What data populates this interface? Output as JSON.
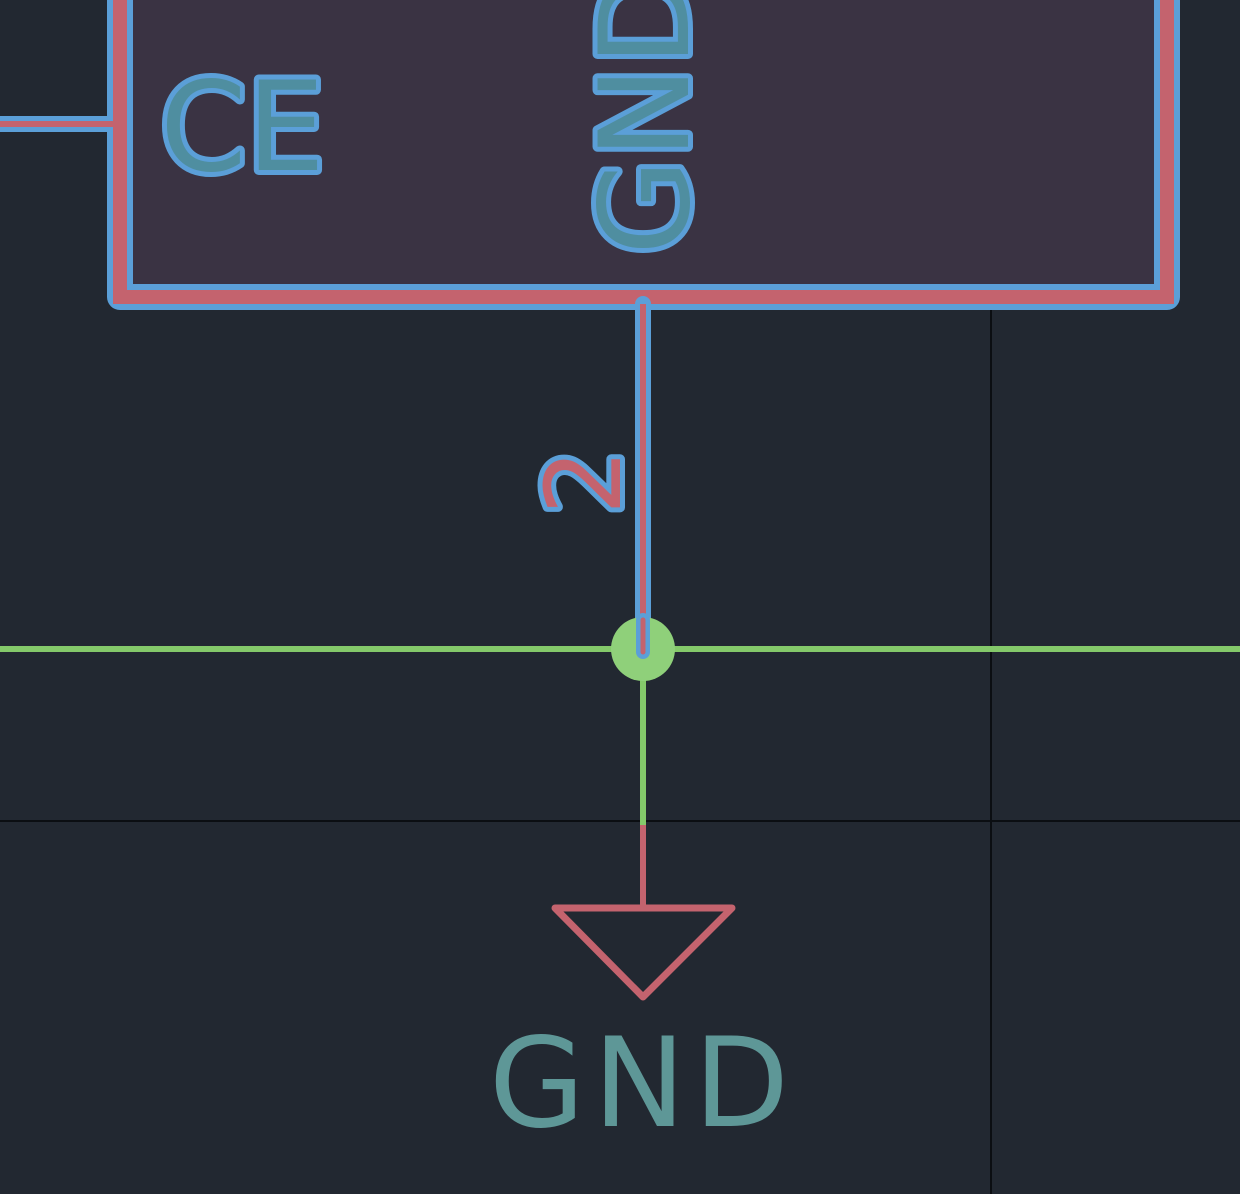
{
  "schematic": {
    "component": {
      "pins": [
        {
          "name": "CE"
        },
        {
          "name": "GND",
          "number": "2"
        }
      ]
    },
    "power_symbol": {
      "label": "GND"
    },
    "colors": {
      "background": "#222831",
      "component_body_fill": "#3a3343",
      "component_outline": "#c4636e",
      "selection_highlight": "#5b9fd8",
      "pin_label_fill": "#4f8ea0",
      "wire": "#84c96a",
      "junction": "#8fd07a",
      "power_symbol": "#c4636e",
      "power_label": "#5e9797",
      "grid_line": "#0b0e12"
    }
  }
}
